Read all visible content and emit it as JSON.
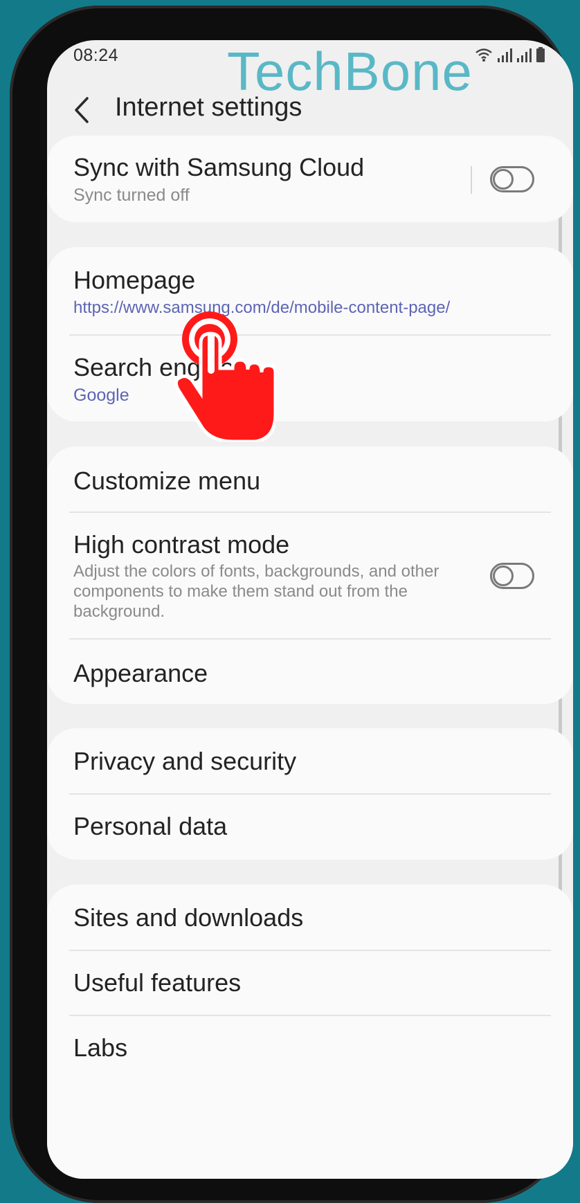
{
  "status": {
    "time": "08:24"
  },
  "watermark": "TechBone",
  "header": {
    "title": "Internet settings"
  },
  "sync": {
    "title": "Sync with Samsung Cloud",
    "subtitle": "Sync turned off",
    "enabled": false
  },
  "homepage": {
    "title": "Homepage",
    "value": "https://www.samsung.com/de/mobile-content-page/"
  },
  "search_engine": {
    "title": "Search engine",
    "value": "Google"
  },
  "customize_menu": {
    "title": "Customize menu"
  },
  "high_contrast": {
    "title": "High contrast mode",
    "description": "Adjust the colors of fonts, backgrounds, and other components to make them stand out from the background.",
    "enabled": false
  },
  "appearance": {
    "title": "Appearance"
  },
  "privacy": {
    "title": "Privacy and security"
  },
  "personal_data": {
    "title": "Personal data"
  },
  "sites_downloads": {
    "title": "Sites and downloads"
  },
  "useful_features": {
    "title": "Useful features"
  },
  "labs": {
    "title": "Labs"
  },
  "colors": {
    "accent_link": "#5d64b4",
    "pointer": "#ff1a1a",
    "watermark": "#5ab8c6"
  }
}
